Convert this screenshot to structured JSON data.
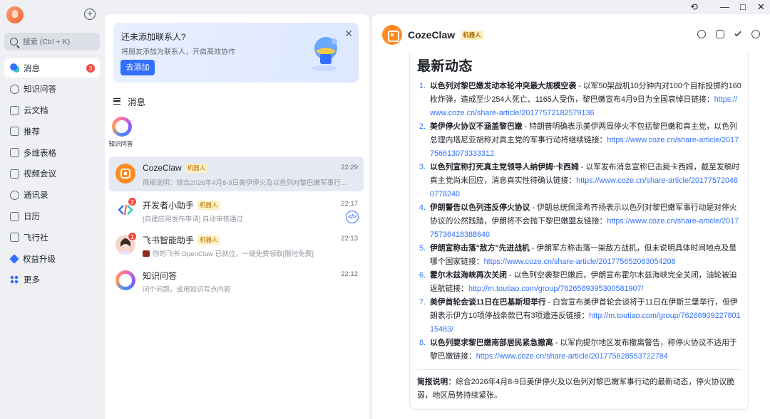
{
  "nav": {
    "search_label": "搜索 (Ctrl + K)",
    "items": [
      {
        "label": "消息",
        "icon": "message-icon",
        "badge": "3"
      },
      {
        "label": "知识问答",
        "icon": "knowledge-icon"
      },
      {
        "label": "云文档",
        "icon": "doc-icon"
      },
      {
        "label": "推荐",
        "icon": "recommend-icon"
      },
      {
        "label": "多维表格",
        "icon": "table-icon"
      },
      {
        "label": "视频会议",
        "icon": "video-icon"
      },
      {
        "label": "通讯录",
        "icon": "contacts-icon"
      },
      {
        "label": "日历",
        "icon": "calendar-icon"
      },
      {
        "label": "飞行社",
        "icon": "feixingshe-icon"
      },
      {
        "label": "权益升级",
        "icon": "upgrade-icon"
      },
      {
        "label": "更多",
        "icon": "more-icon"
      }
    ]
  },
  "promo": {
    "title": "还未添加联系人?",
    "subtitle": "将朋友添加为联系人，开启高效协作",
    "button": "去添加"
  },
  "section_title": "消息",
  "pinned": {
    "label": "知识问答"
  },
  "conversations": [
    {
      "name": "CozeClaw",
      "tag": "机器人",
      "time": "22:29",
      "preview": "简报说明：综合2026年4月8-9日美伊停火及以色列对黎巴嫩军事行...",
      "avatar_color": "#ff8a1f"
    },
    {
      "name": "开发者小助手",
      "tag": "机器人",
      "time": "22:17",
      "preview": "[自建应用发布申请] 自动审核通过",
      "badge": "2",
      "status": "</>"
    },
    {
      "name": "飞书智能助手",
      "tag": "机器人",
      "time": "22:13",
      "preview": "你的飞书 OpenClaw 已就位，一键免费领取[限时免费]",
      "badge": "1"
    },
    {
      "name": "知识问答",
      "time": "22:12",
      "preview": "问个问题，或用知识写点内容"
    }
  ],
  "detail": {
    "title": "CozeClaw",
    "tag": "机器人",
    "heading": "最新动态",
    "news": [
      {
        "num": "1.",
        "title": "以色列对黎巴嫩发动本轮冲突最大规模空袭",
        "text": " - 以军50架战机10分钟内对100个目标投掷约160枚炸弹，造成至少254人死亡、1165人受伤，黎巴嫩宣布4月9日为全国哀悼日链接：",
        "link": "https://www.coze.cn/share-article/2017757218​2579136"
      },
      {
        "num": "2.",
        "title": "美伊停火协议不涵盖黎巴嫩",
        "text": " - 特朗普明确表示美伊两周停火不包括黎巴嫩和真主党，以色列总理内塔尼亚胡称对真主党的军事行动将继续链接：",
        "link": "https://www.coze.cn/share-article/2017756613073333312"
      },
      {
        "num": "3.",
        "title": "以色列宣称打死真主党领导人纳伊姆·卡西姆",
        "text": " - 以军发布消息宣称已击毙卡西姆，截至发稿时真主党尚未回应，消息真实性待确认链接：",
        "link": "https://www.coze.cn/share-article/2017757204807782​40"
      },
      {
        "num": "4.",
        "title": "伊朗警告以色列违反停火协议",
        "text": " - 伊朗总统佩泽希齐扬表示以色列对黎巴嫩军事行动是对停火协议的公然践踏，伊朗将不会抛下黎巴嫩盟友链接：",
        "link": "https://www.coze.cn/share-article/2017757364183886​40"
      },
      {
        "num": "5.",
        "title": "伊朗宣称击落\"敌方\"先进战机",
        "text": " - 伊朗军方称击落一架敌方战机，但未说明具体时间地点及是哪个国家链接：",
        "link": "https://www.coze.cn/share-article/2017756520630542​08"
      },
      {
        "num": "6.",
        "title": "霍尔木兹海峡再次关闭",
        "text": " - 以色列空袭黎巴嫩后，伊朗宣布霍尔木兹海峡完全关闭，油轮被迫返航链接：",
        "link": "http://m.toutiao.com/group/7626569395300581907/"
      },
      {
        "num": "7.",
        "title": "美伊首轮会谈11日在巴基斯坦举行",
        "text": " - 白宫宣布美伊首轮会谈将于11日在伊斯兰堡举行，但伊朗表示伊方10项停战条款已有3项遭违反链接：",
        "link": "http://m.toutiao.com/group/7626690922780115483/"
      },
      {
        "num": "8.",
        "title": "以色列要求黎巴嫩南部居民紧急撤离",
        "text": " - 以军向提尔地区发布撤离警告，称停火协议不适用于黎巴嫩链接：",
        "link": "https://www.coze.cn/share-article/2017756285537227​84"
      }
    ],
    "brief_label": "简报说明",
    "brief_text": "：综合2026年4月8-9日美伊停火及以色列对黎巴嫩军事行动的最新动态，停火协议脆弱，地区局势持续紧张。"
  }
}
